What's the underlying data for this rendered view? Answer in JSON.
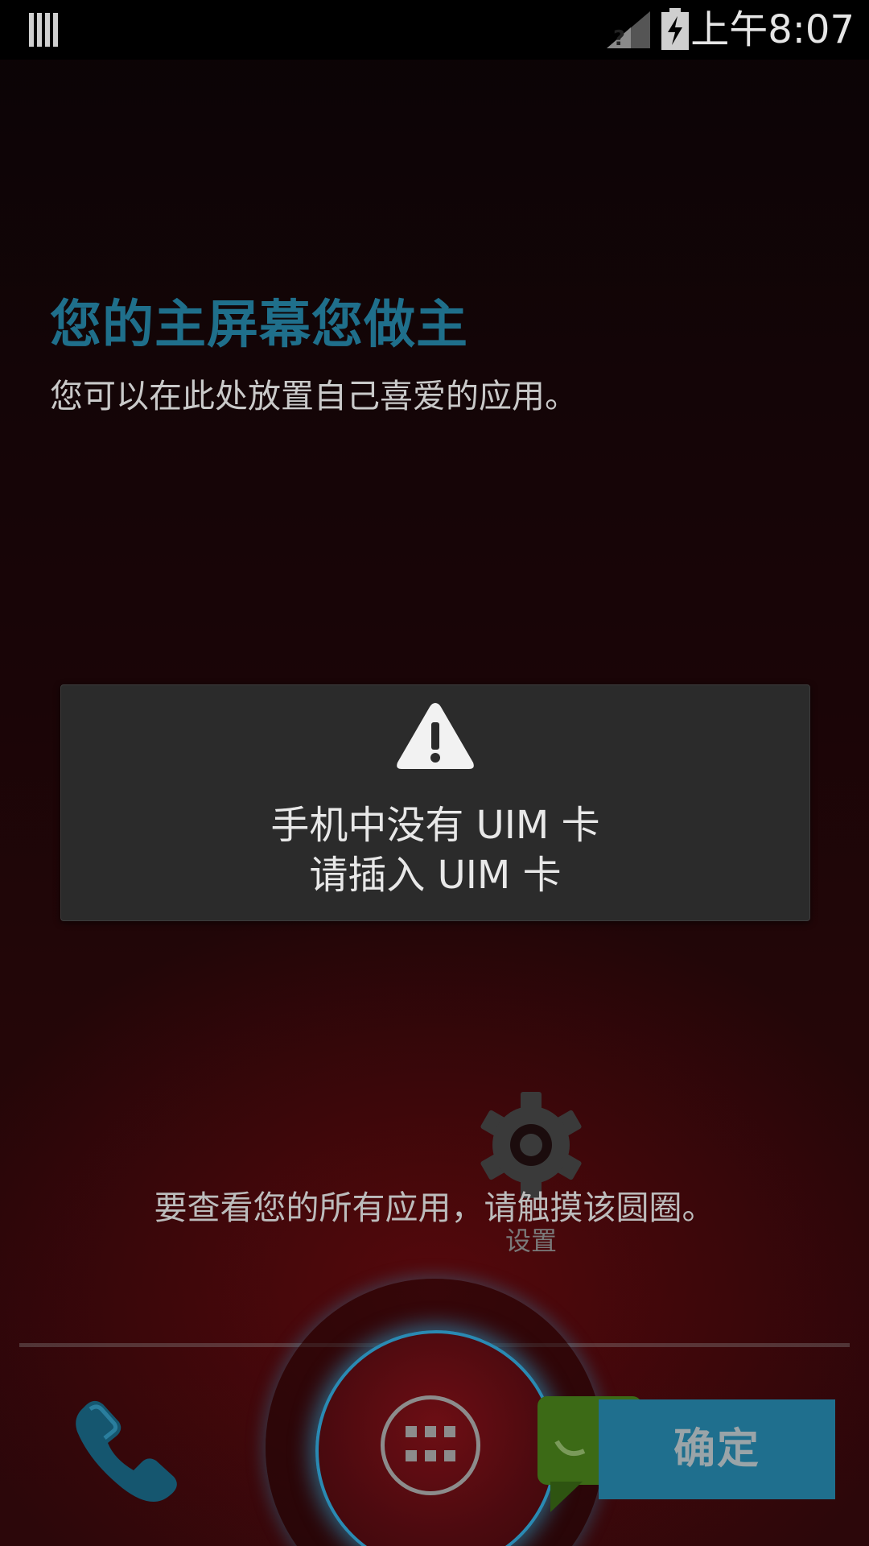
{
  "status_bar": {
    "time": "上午8:07",
    "icons": [
      "storage-bars-icon",
      "no-sim-signal-icon",
      "battery-charging-icon"
    ]
  },
  "home_hint": {
    "title": "您的主屏幕您做主",
    "subtitle": "您可以在此处放置自己喜爱的应用。"
  },
  "toast": {
    "icon": "warning-icon",
    "line1": "手机中没有 UIM 卡",
    "line2": "请插入 UIM 卡"
  },
  "all_apps_hint": "要查看您的所有应用，请触摸该圆圈。",
  "settings_shortcut": {
    "icon": "gear-icon",
    "label": "设置"
  },
  "dock": {
    "left_icon": "phone-icon",
    "center_icon": "apps-grid-icon",
    "right_icon": "messaging-icon"
  },
  "ok_button": {
    "label": "确定"
  },
  "colors": {
    "accent": "#1f6f8b",
    "ring_glow": "#2a8ab3",
    "toast_bg": "#2b2b2b"
  }
}
